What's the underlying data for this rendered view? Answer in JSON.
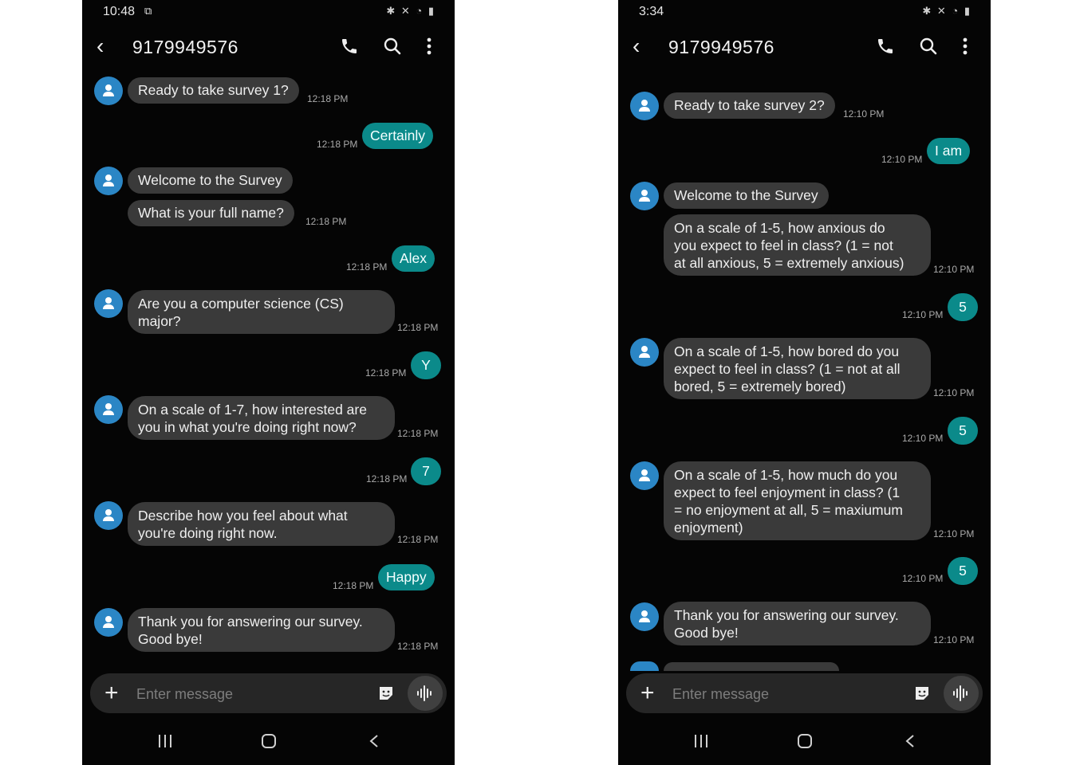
{
  "left": {
    "status_time": "10:48",
    "contact": "9179949576",
    "messages": [
      {
        "dir": "in",
        "avatar": true,
        "text": "Ready to take survey 1?",
        "time": "12:18 PM"
      },
      {
        "dir": "out",
        "text": "Certainly",
        "time": "12:18 PM"
      },
      {
        "dir": "in",
        "avatar": true,
        "text": "Welcome to the Survey",
        "time": ""
      },
      {
        "dir": "in",
        "avatar": false,
        "text": "What is your full name?",
        "time": "12:18 PM"
      },
      {
        "dir": "out",
        "text": "Alex",
        "time": "12:18 PM"
      },
      {
        "dir": "in",
        "avatar": true,
        "text": "Are you a computer science (CS)\nmajor?",
        "time": "12:18 PM"
      },
      {
        "dir": "out",
        "text": "Y",
        "time": "12:18 PM"
      },
      {
        "dir": "in",
        "avatar": true,
        "text": "On a scale of 1-7, how interested are\nyou in what you're doing right now?",
        "time": "12:18 PM"
      },
      {
        "dir": "out",
        "text": "7",
        "time": "12:18 PM"
      },
      {
        "dir": "in",
        "avatar": true,
        "text": "Describe how you feel about what\nyou're doing right now.",
        "time": "12:18 PM"
      },
      {
        "dir": "out",
        "text": "Happy",
        "time": "12:18 PM"
      },
      {
        "dir": "in",
        "avatar": true,
        "text": "Thank you for answering our survey.\nGood bye!",
        "time": "12:18 PM"
      }
    ],
    "composer_placeholder": "Enter message"
  },
  "right": {
    "status_time": "3:34",
    "contact": "9179949576",
    "messages": [
      {
        "dir": "in",
        "avatar": true,
        "text": "Ready to take survey 2?",
        "time": "12:10 PM"
      },
      {
        "dir": "out",
        "text": "I am",
        "time": "12:10 PM"
      },
      {
        "dir": "in",
        "avatar": true,
        "text": "Welcome to the Survey",
        "time": ""
      },
      {
        "dir": "in",
        "avatar": false,
        "text": "On a scale of 1-5, how anxious do\nyou expect to feel in class? (1 = not\nat all anxious, 5 = extremely anxious)",
        "time": "12:10 PM"
      },
      {
        "dir": "out",
        "text": "5",
        "time": "12:10 PM"
      },
      {
        "dir": "in",
        "avatar": true,
        "text": "On a scale of 1-5, how bored do you\nexpect to feel in class? (1 = not at all\nbored, 5 = extremely bored)",
        "time": "12:10 PM"
      },
      {
        "dir": "out",
        "text": "5",
        "time": "12:10 PM"
      },
      {
        "dir": "in",
        "avatar": true,
        "text": "On a scale of 1-5, how much do you\nexpect to feel enjoyment in class? (1\n= no enjoyment at all, 5 = maxiumum\nenjoyment)",
        "time": "12:10 PM"
      },
      {
        "dir": "out",
        "text": "5",
        "time": "12:10 PM"
      },
      {
        "dir": "in",
        "avatar": true,
        "text": "Thank you for answering our survey.\nGood bye!",
        "time": "12:10 PM"
      }
    ],
    "composer_placeholder": "Enter message"
  },
  "colors": {
    "incoming_bubble": "#3a3a3a",
    "outgoing_bubble": "#0b8a8a",
    "avatar": "#2b86c5",
    "background": "#050505"
  },
  "icons": {
    "back": "chevron-left-icon",
    "call": "phone-icon",
    "search": "search-icon",
    "more": "more-vert-icon",
    "attach": "plus-icon",
    "sticker": "sticker-icon",
    "voice": "voice-input-icon"
  }
}
